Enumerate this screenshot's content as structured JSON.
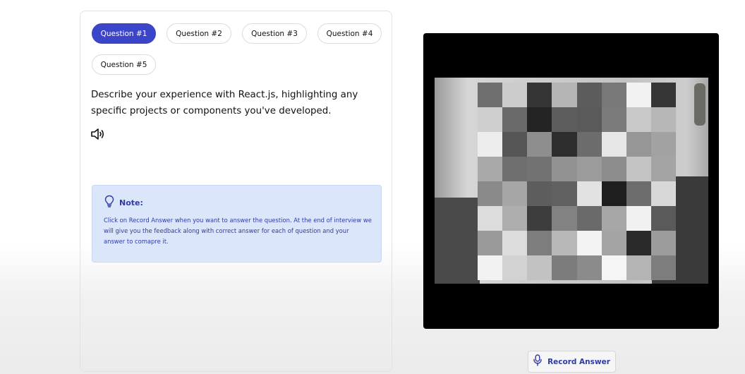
{
  "tabs": [
    {
      "label": "Question #1",
      "active": true
    },
    {
      "label": "Question #2",
      "active": false
    },
    {
      "label": "Question #3",
      "active": false
    },
    {
      "label": "Question #4",
      "active": false
    },
    {
      "label": "Question #5",
      "active": false
    }
  ],
  "question": {
    "text": "Describe your experience with React.js, highlighting any specific projects or components you've developed.",
    "speaker_icon": "speaker-icon"
  },
  "note": {
    "icon": "lightbulb-icon",
    "title": "Note:",
    "body": "Click on Record Answer when you want to answer the question. At the end of interview we will give you the feedback along with correct answer for each of question and your answer to comapre it."
  },
  "video": {
    "mosaic_gray_values": [
      "#6f6f6f",
      "#cccccc",
      "#353535",
      "#b4b4b4",
      "#5c5c5c",
      "#787878",
      "#f2f2f2",
      "#363636",
      "#cfcfcf",
      "#6a6a6a",
      "#242424",
      "#5d5d5d",
      "#5a5a5a",
      "#7b7b7b",
      "#c8c8c8",
      "#b7b7b7",
      "#ededed",
      "#555555",
      "#8e8e8e",
      "#2e2e2e",
      "#6c6c6c",
      "#e6e6e6",
      "#969696",
      "#a2a2a2",
      "#a9a9a9",
      "#6e6e6e",
      "#727272",
      "#929292",
      "#9b9b9b",
      "#8c8c8c",
      "#c4c4c4",
      "#a4a4a4",
      "#8a8a8a",
      "#a6a6a6",
      "#5d5d5d",
      "#616161",
      "#e2e2e2",
      "#1e1e1e",
      "#6d6d6d",
      "#d8d8d8",
      "#dcdcdc",
      "#aeaeae",
      "#3d3d3d",
      "#828282",
      "#6a6a6a",
      "#a7a7a7",
      "#f1f1f1",
      "#5a5a5a",
      "#9a9a9a",
      "#dcdcdc",
      "#7d7d7d",
      "#b8b8b8",
      "#f3f3f3",
      "#a4a4a4",
      "#2a2a2a",
      "#9c9c9c",
      "#f2f2f2",
      "#d2d2d2",
      "#c2c2c2",
      "#7c7c7c",
      "#8b8b8b",
      "#f5f5f5",
      "#b4b4b4",
      "#7d7d7d"
    ]
  },
  "record_button": {
    "icon": "microphone-icon",
    "label": "Record Answer"
  },
  "colors": {
    "accent": "#3b45c9",
    "note_bg": "#dbe6fb",
    "note_text": "#2f3aa6"
  }
}
